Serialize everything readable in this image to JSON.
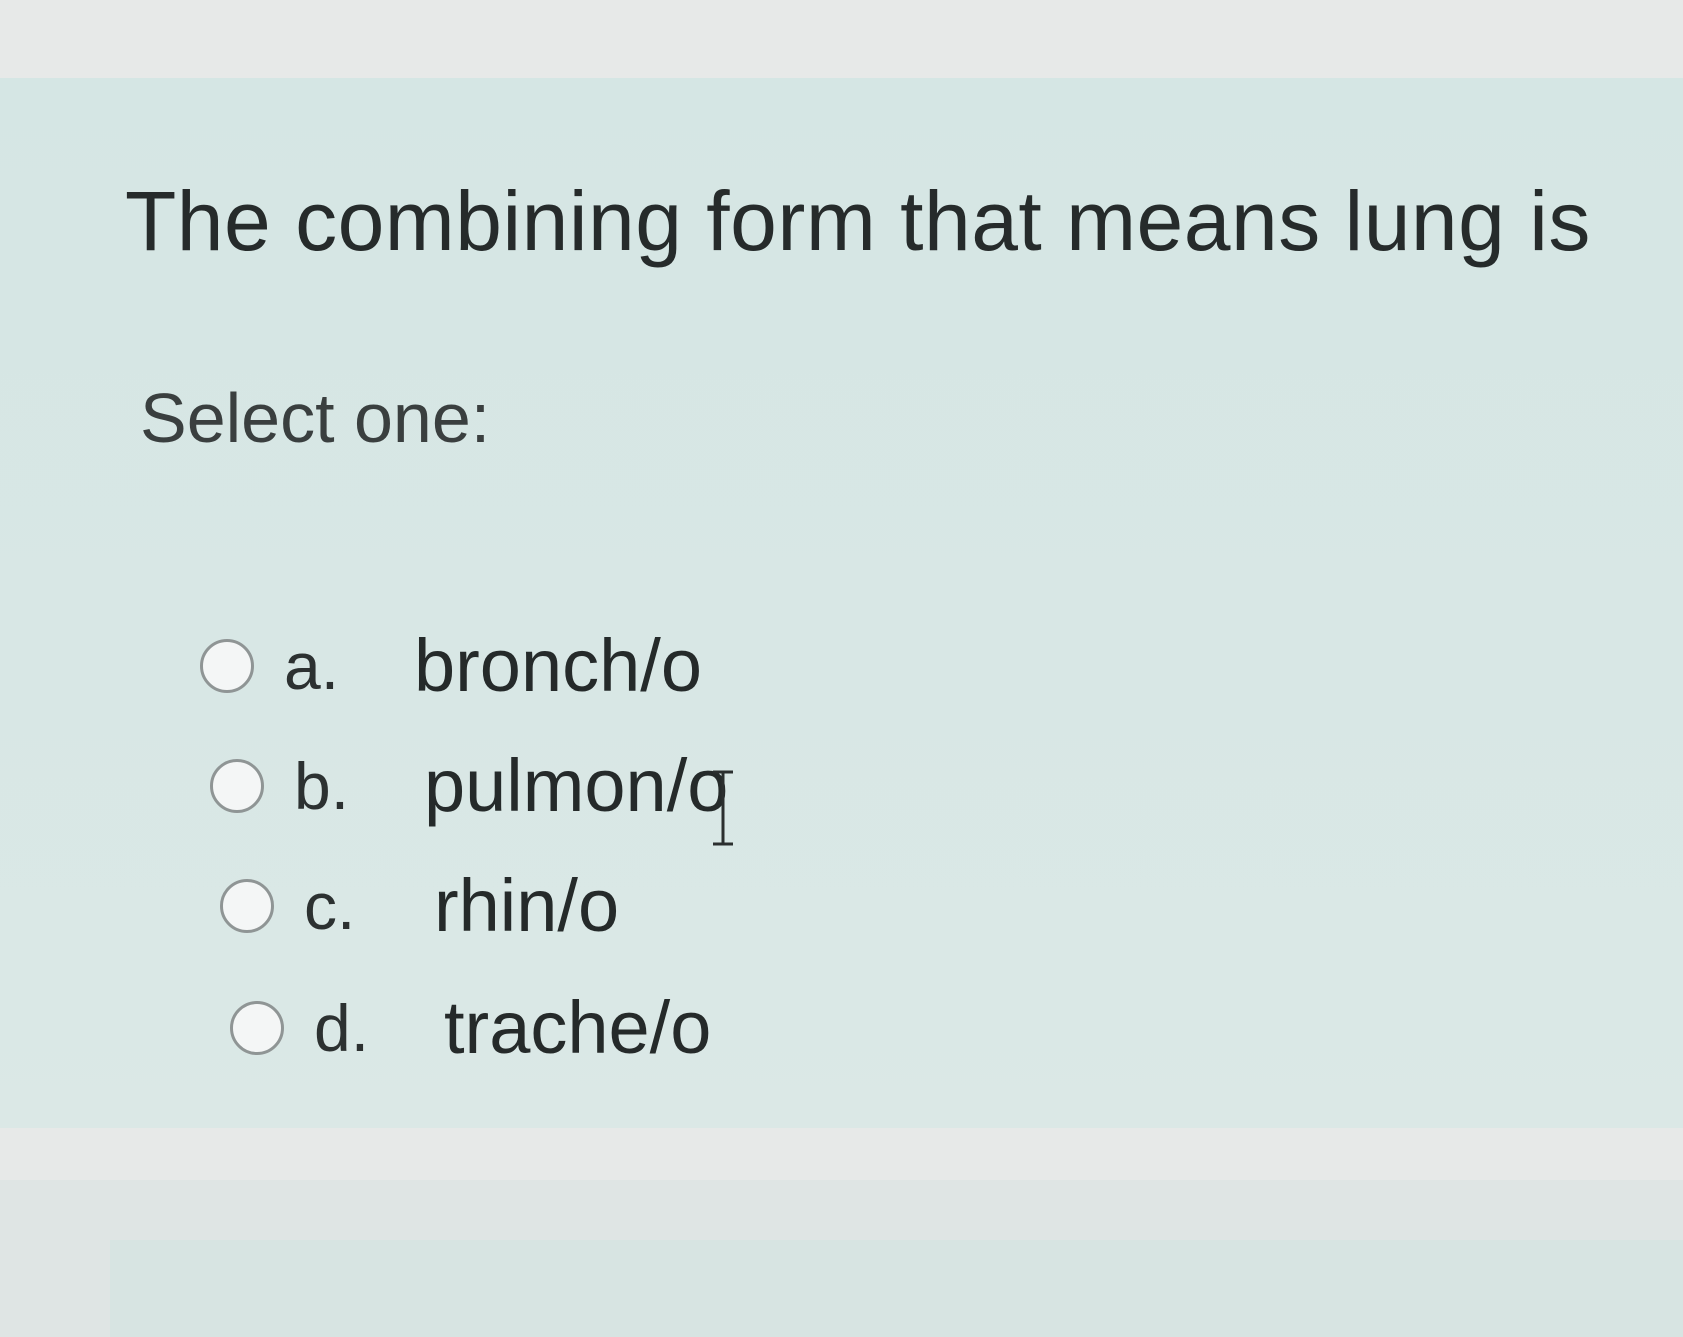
{
  "question": {
    "text": "The combining form that means lung is",
    "prompt": "Select one:"
  },
  "options": [
    {
      "letter": "a.",
      "value": "bronch/o"
    },
    {
      "letter": "b.",
      "value": "pulmon/o"
    },
    {
      "letter": "c.",
      "value": "rhin/o"
    },
    {
      "letter": "d.",
      "value": "trache/o"
    }
  ],
  "colors": {
    "panel_background": "#d8e7e5",
    "text": "#262b2b",
    "radio_border": "#8f9595"
  },
  "icons": {
    "radio": "radio-button-icon",
    "cursor": "text-cursor-icon"
  }
}
